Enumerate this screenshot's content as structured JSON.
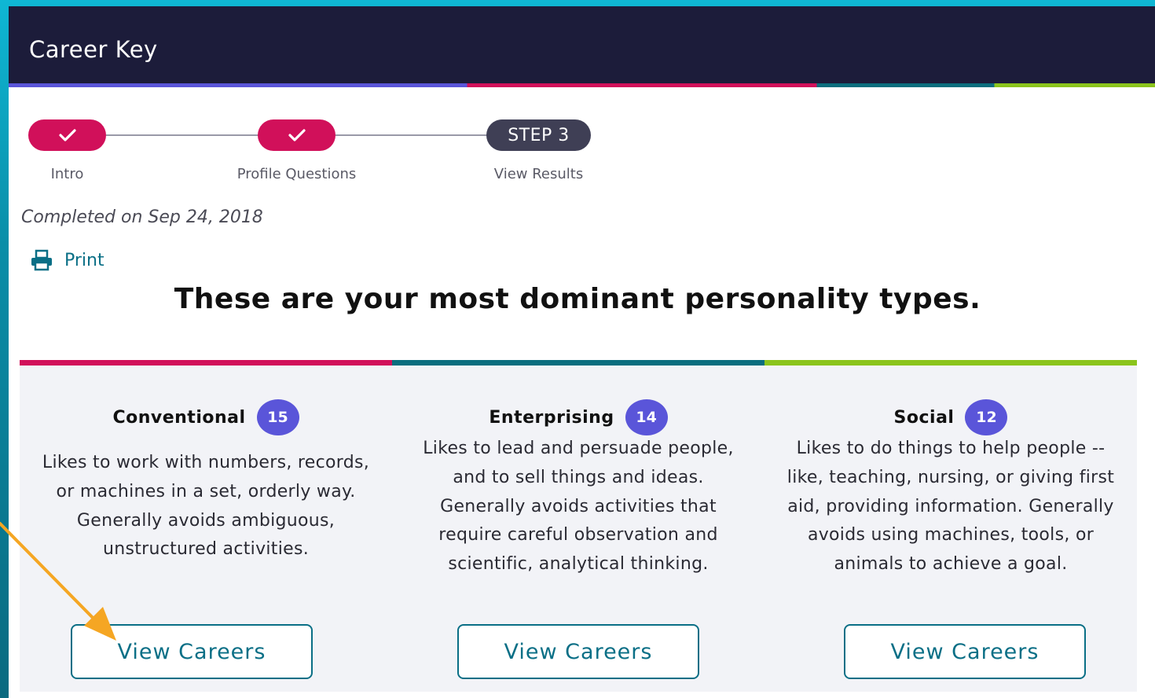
{
  "header": {
    "title": "Career Key"
  },
  "stepper": {
    "steps": [
      {
        "label": "Intro",
        "state": "done"
      },
      {
        "label": "Profile Questions",
        "state": "done"
      },
      {
        "label": "View Results",
        "state": "current",
        "pill_text": "STEP 3"
      }
    ]
  },
  "completed": "Completed on Sep 24, 2018",
  "print_label": "Print",
  "headline": "These are your most dominant personality types.",
  "cards": [
    {
      "name": "Conventional",
      "score": "15",
      "accent": "#d1105a",
      "description": "Likes to work with numbers, records, or machines in a set, orderly way. Generally avoids ambiguous, unstructured activities.",
      "button_label": "View Careers"
    },
    {
      "name": "Enterprising",
      "score": "14",
      "accent": "#0b6e7e",
      "description": "Likes to lead and persuade people, and to sell things and ideas. Generally avoids activities that require careful observation and scientific, analytical thinking.",
      "button_label": "View Careers"
    },
    {
      "name": "Social",
      "score": "12",
      "accent": "#8bc41c",
      "description": "Likes to do things to help people -- like, teaching, nursing, or giving first aid, providing information. Generally avoids using machines, tools, or animals to achieve a goal.",
      "button_label": "View Careers"
    }
  ],
  "colors": {
    "header_bg": "#1c1c3a",
    "brand_magenta": "#d1105a",
    "badge_purple": "#5a55d9",
    "link_teal": "#0a6f86",
    "annotation_arrow": "#f5a623"
  }
}
